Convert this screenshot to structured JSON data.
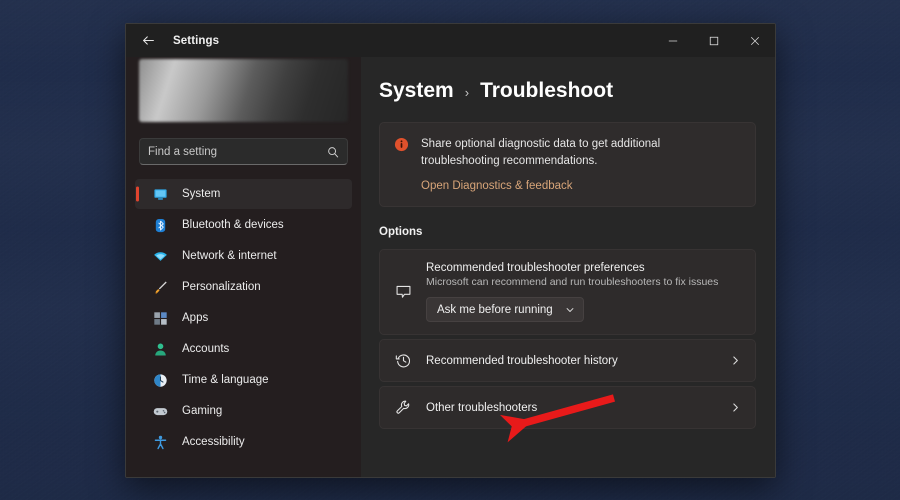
{
  "window": {
    "app_title": "Settings",
    "back_icon": "back-arrow-icon",
    "controls": {
      "minimize": "—",
      "maximize": "☐",
      "close": "✕"
    }
  },
  "sidebar": {
    "account_card": "blurred-account-banner",
    "search": {
      "placeholder": "Find a setting",
      "value": "",
      "icon": "search-icon"
    },
    "items": [
      {
        "label": "System",
        "icon": "monitor-icon",
        "active": true
      },
      {
        "label": "Bluetooth & devices",
        "icon": "bluetooth-icon",
        "active": false
      },
      {
        "label": "Network & internet",
        "icon": "wifi-icon",
        "active": false
      },
      {
        "label": "Personalization",
        "icon": "paintbrush-icon",
        "active": false
      },
      {
        "label": "Apps",
        "icon": "apps-grid-icon",
        "active": false
      },
      {
        "label": "Accounts",
        "icon": "person-icon",
        "active": false
      },
      {
        "label": "Time & language",
        "icon": "clock-icon",
        "active": false
      },
      {
        "label": "Gaming",
        "icon": "gamepad-icon",
        "active": false
      },
      {
        "label": "Accessibility",
        "icon": "accessibility-icon",
        "active": false
      }
    ]
  },
  "main": {
    "breadcrumb": {
      "parent": "System",
      "separator": "›",
      "current": "Troubleshoot"
    },
    "banner": {
      "icon": "info-circle-icon",
      "text": "Share optional diagnostic data to get additional troubleshooting recommendations.",
      "link_label": "Open Diagnostics & feedback"
    },
    "options_heading": "Options",
    "preferences_card": {
      "icon": "speech-bubble-icon",
      "title": "Recommended troubleshooter preferences",
      "subtitle": "Microsoft can recommend and run troubleshooters to fix issues",
      "dropdown": {
        "value": "Ask me before running",
        "chevron_icon": "chevron-down-icon"
      }
    },
    "rows": [
      {
        "label": "Recommended troubleshooter history",
        "icon": "history-clock-icon",
        "chevron": "chevron-right-icon"
      },
      {
        "label": "Other troubleshooters",
        "icon": "wrench-icon",
        "chevron": "chevron-right-icon"
      }
    ]
  },
  "annotation": {
    "arrow_color": "#e81a1a",
    "points_at": "Other troubleshooters"
  },
  "colors": {
    "accent_selected": "#e0442e",
    "banner_link": "#d8a579",
    "window_bg": "#202020",
    "sidebar_bg": "#241e1f",
    "content_bg": "#272727",
    "desktop_bg": "#1e2b49"
  }
}
